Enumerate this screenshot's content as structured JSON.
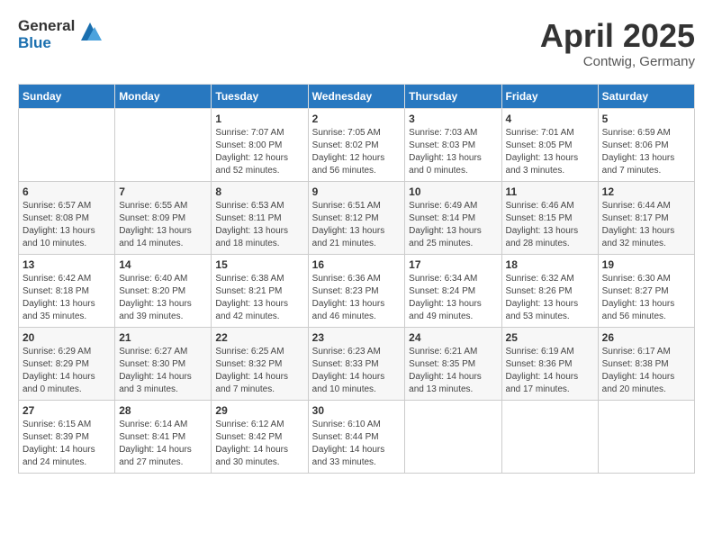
{
  "header": {
    "logo_general": "General",
    "logo_blue": "Blue",
    "month": "April 2025",
    "location": "Contwig, Germany"
  },
  "weekdays": [
    "Sunday",
    "Monday",
    "Tuesday",
    "Wednesday",
    "Thursday",
    "Friday",
    "Saturday"
  ],
  "weeks": [
    [
      {
        "day": "",
        "detail": ""
      },
      {
        "day": "",
        "detail": ""
      },
      {
        "day": "1",
        "detail": "Sunrise: 7:07 AM\nSunset: 8:00 PM\nDaylight: 12 hours and 52 minutes."
      },
      {
        "day": "2",
        "detail": "Sunrise: 7:05 AM\nSunset: 8:02 PM\nDaylight: 12 hours and 56 minutes."
      },
      {
        "day": "3",
        "detail": "Sunrise: 7:03 AM\nSunset: 8:03 PM\nDaylight: 13 hours and 0 minutes."
      },
      {
        "day": "4",
        "detail": "Sunrise: 7:01 AM\nSunset: 8:05 PM\nDaylight: 13 hours and 3 minutes."
      },
      {
        "day": "5",
        "detail": "Sunrise: 6:59 AM\nSunset: 8:06 PM\nDaylight: 13 hours and 7 minutes."
      }
    ],
    [
      {
        "day": "6",
        "detail": "Sunrise: 6:57 AM\nSunset: 8:08 PM\nDaylight: 13 hours and 10 minutes."
      },
      {
        "day": "7",
        "detail": "Sunrise: 6:55 AM\nSunset: 8:09 PM\nDaylight: 13 hours and 14 minutes."
      },
      {
        "day": "8",
        "detail": "Sunrise: 6:53 AM\nSunset: 8:11 PM\nDaylight: 13 hours and 18 minutes."
      },
      {
        "day": "9",
        "detail": "Sunrise: 6:51 AM\nSunset: 8:12 PM\nDaylight: 13 hours and 21 minutes."
      },
      {
        "day": "10",
        "detail": "Sunrise: 6:49 AM\nSunset: 8:14 PM\nDaylight: 13 hours and 25 minutes."
      },
      {
        "day": "11",
        "detail": "Sunrise: 6:46 AM\nSunset: 8:15 PM\nDaylight: 13 hours and 28 minutes."
      },
      {
        "day": "12",
        "detail": "Sunrise: 6:44 AM\nSunset: 8:17 PM\nDaylight: 13 hours and 32 minutes."
      }
    ],
    [
      {
        "day": "13",
        "detail": "Sunrise: 6:42 AM\nSunset: 8:18 PM\nDaylight: 13 hours and 35 minutes."
      },
      {
        "day": "14",
        "detail": "Sunrise: 6:40 AM\nSunset: 8:20 PM\nDaylight: 13 hours and 39 minutes."
      },
      {
        "day": "15",
        "detail": "Sunrise: 6:38 AM\nSunset: 8:21 PM\nDaylight: 13 hours and 42 minutes."
      },
      {
        "day": "16",
        "detail": "Sunrise: 6:36 AM\nSunset: 8:23 PM\nDaylight: 13 hours and 46 minutes."
      },
      {
        "day": "17",
        "detail": "Sunrise: 6:34 AM\nSunset: 8:24 PM\nDaylight: 13 hours and 49 minutes."
      },
      {
        "day": "18",
        "detail": "Sunrise: 6:32 AM\nSunset: 8:26 PM\nDaylight: 13 hours and 53 minutes."
      },
      {
        "day": "19",
        "detail": "Sunrise: 6:30 AM\nSunset: 8:27 PM\nDaylight: 13 hours and 56 minutes."
      }
    ],
    [
      {
        "day": "20",
        "detail": "Sunrise: 6:29 AM\nSunset: 8:29 PM\nDaylight: 14 hours and 0 minutes."
      },
      {
        "day": "21",
        "detail": "Sunrise: 6:27 AM\nSunset: 8:30 PM\nDaylight: 14 hours and 3 minutes."
      },
      {
        "day": "22",
        "detail": "Sunrise: 6:25 AM\nSunset: 8:32 PM\nDaylight: 14 hours and 7 minutes."
      },
      {
        "day": "23",
        "detail": "Sunrise: 6:23 AM\nSunset: 8:33 PM\nDaylight: 14 hours and 10 minutes."
      },
      {
        "day": "24",
        "detail": "Sunrise: 6:21 AM\nSunset: 8:35 PM\nDaylight: 14 hours and 13 minutes."
      },
      {
        "day": "25",
        "detail": "Sunrise: 6:19 AM\nSunset: 8:36 PM\nDaylight: 14 hours and 17 minutes."
      },
      {
        "day": "26",
        "detail": "Sunrise: 6:17 AM\nSunset: 8:38 PM\nDaylight: 14 hours and 20 minutes."
      }
    ],
    [
      {
        "day": "27",
        "detail": "Sunrise: 6:15 AM\nSunset: 8:39 PM\nDaylight: 14 hours and 24 minutes."
      },
      {
        "day": "28",
        "detail": "Sunrise: 6:14 AM\nSunset: 8:41 PM\nDaylight: 14 hours and 27 minutes."
      },
      {
        "day": "29",
        "detail": "Sunrise: 6:12 AM\nSunset: 8:42 PM\nDaylight: 14 hours and 30 minutes."
      },
      {
        "day": "30",
        "detail": "Sunrise: 6:10 AM\nSunset: 8:44 PM\nDaylight: 14 hours and 33 minutes."
      },
      {
        "day": "",
        "detail": ""
      },
      {
        "day": "",
        "detail": ""
      },
      {
        "day": "",
        "detail": ""
      }
    ]
  ]
}
